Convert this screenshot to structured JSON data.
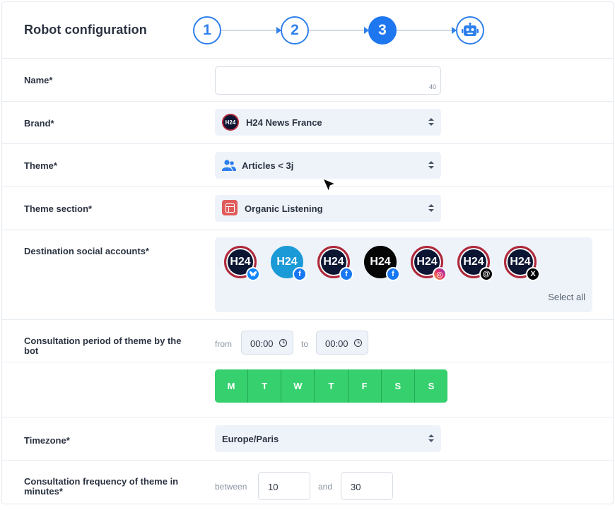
{
  "header": {
    "title": "Robot configuration",
    "steps": [
      {
        "label": "1",
        "state": "done"
      },
      {
        "label": "2",
        "state": "done"
      },
      {
        "label": "3",
        "state": "active"
      },
      {
        "label": "robot-icon",
        "state": "final"
      }
    ]
  },
  "form": {
    "name": {
      "label": "Name*",
      "value": "",
      "counter": "40"
    },
    "brand": {
      "label": "Brand*",
      "value": "H24 News France",
      "logo_text": "H24"
    },
    "theme": {
      "label": "Theme*",
      "value": "Articles < 3j",
      "icon": "users-icon"
    },
    "theme_section": {
      "label": "Theme section*",
      "value": "Organic Listening",
      "icon": "layout-icon"
    },
    "destinations": {
      "label": "Destination social accounts*",
      "select_all": "Select all",
      "accounts": [
        {
          "avatar_text": "H24",
          "network": "bluesky",
          "network_glyph": "🦋"
        },
        {
          "avatar_text": "H24",
          "network": "facebook",
          "network_glyph": "f"
        },
        {
          "avatar_text": "H24",
          "network": "facebook",
          "network_glyph": "f"
        },
        {
          "avatar_text": "H24",
          "network": "facebook",
          "network_glyph": "f"
        },
        {
          "avatar_text": "H24",
          "network": "instagram",
          "network_glyph": "◎"
        },
        {
          "avatar_text": "H24",
          "network": "threads",
          "network_glyph": "@"
        },
        {
          "avatar_text": "H24",
          "network": "x",
          "network_glyph": "X"
        }
      ]
    },
    "consultation_period": {
      "label": "Consultation period of theme by the bot",
      "from_label": "from",
      "from_value": "00:00",
      "to_label": "to",
      "to_value": "00:00"
    },
    "days": [
      "M",
      "T",
      "W",
      "T",
      "F",
      "S",
      "S"
    ],
    "timezone": {
      "label": "Timezone*",
      "value": "Europe/Paris"
    },
    "frequency": {
      "label": "Consultation frequency of theme in minutes*",
      "between_label": "between",
      "min_value": "10",
      "and_label": "and",
      "max_value": "30"
    }
  },
  "colors": {
    "accent": "#1f77f0",
    "days_active": "#36d06e",
    "select_bg": "#eef3fa"
  }
}
